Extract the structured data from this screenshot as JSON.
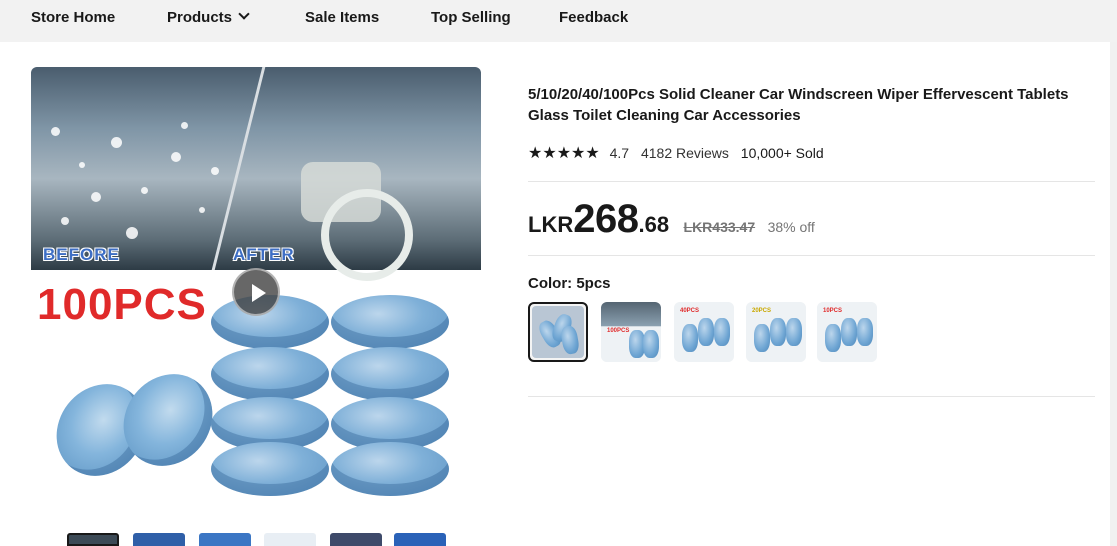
{
  "nav": {
    "items": [
      {
        "label": "Store Home"
      },
      {
        "label": "Products"
      },
      {
        "label": "Sale Items"
      },
      {
        "label": "Top Selling"
      },
      {
        "label": "Feedback"
      }
    ]
  },
  "gallery": {
    "before_text": "BEFORE",
    "after_text": "AFTER",
    "pcs_text": "100PCS",
    "play_icon": "play-icon"
  },
  "product": {
    "title": "5/10/20/40/100Pcs Solid Cleaner Car Windscreen Wiper Effervescent Tablets Glass Toilet Cleaning Car Accessories",
    "stars": "★★★★★",
    "rating": "4.7",
    "reviews": "4182 Reviews",
    "sold": "10,000+ Sold",
    "price_currency": "LKR",
    "price_int": "268",
    "price_dec": ".68",
    "price_original": "LKR433.47",
    "discount": "38% off",
    "color_label": "Color: 5pcs"
  },
  "swatches": {
    "items": [
      {
        "label": ""
      },
      {
        "label": "100PCS"
      },
      {
        "label": "40PCS"
      },
      {
        "label": "20PCS"
      },
      {
        "label": "10PCS"
      }
    ]
  },
  "colors": {
    "nav_bg": "#f2f2f2",
    "text": "#191919",
    "muted": "#757575",
    "red_badge": "#e02a2a"
  }
}
